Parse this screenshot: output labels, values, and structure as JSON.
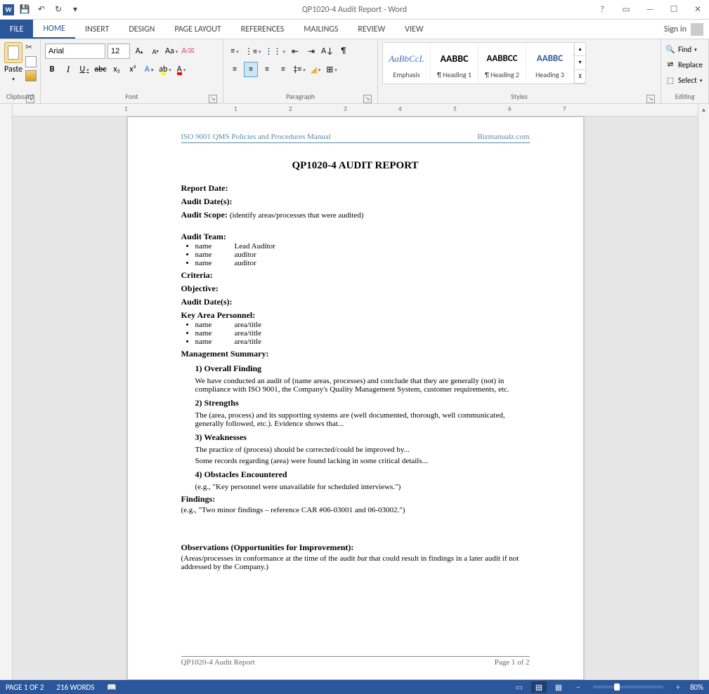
{
  "titlebar": {
    "title": "QP1020-4 Audit Report - Word"
  },
  "qat": {
    "save": "💾",
    "undo": "↶",
    "redo": "↻"
  },
  "tabs": {
    "file": "FILE",
    "home": "HOME",
    "insert": "INSERT",
    "design": "DESIGN",
    "pagelayout": "PAGE LAYOUT",
    "references": "REFERENCES",
    "mailings": "MAILINGS",
    "review": "REVIEW",
    "view": "VIEW",
    "signin": "Sign in"
  },
  "ribbon": {
    "clipboard": {
      "label": "Clipboard",
      "paste": "Paste"
    },
    "font": {
      "label": "Font",
      "name": "Arial",
      "size": "12",
      "bold": "B",
      "italic": "I",
      "underline": "U",
      "strike": "abc",
      "sub": "x₂",
      "sup": "x²",
      "growA": "A",
      "shrinkA": "A",
      "caseAa": "Aa",
      "clear": "⌫",
      "textfx": "A",
      "highlight": "ab",
      "fontcolorA": "A"
    },
    "paragraph": {
      "label": "Paragraph"
    },
    "styles": {
      "label": "Styles",
      "items": [
        {
          "preview": "AaBbCcL",
          "name": "Emphasis",
          "cls": "s1"
        },
        {
          "preview": "AABBC",
          "name": "¶ Heading 1",
          "cls": "s2"
        },
        {
          "preview": "AABBCC",
          "name": "¶ Heading 2",
          "cls": "s3"
        },
        {
          "preview": "AABBC",
          "name": "Heading 3",
          "cls": "s4"
        }
      ]
    },
    "editing": {
      "label": "Editing",
      "find": "Find",
      "replace": "Replace",
      "select": "Select"
    }
  },
  "ruler_numbers": [
    "1",
    "",
    "1",
    "2",
    "3",
    "4",
    "5",
    "6",
    "7"
  ],
  "document": {
    "header_left": "ISO 9001 QMS Policies and Procedures Manual",
    "header_right": "Bizmanualz.com",
    "title": "QP1020-4 AUDIT REPORT",
    "report_date_label": "Report Date:",
    "audit_dates_label": "Audit Date(s):",
    "audit_scope_label": "Audit Scope:",
    "audit_scope_hint": "(identify areas/processes that were audited)",
    "audit_team_label": "Audit Team:",
    "team": [
      {
        "name": "name",
        "role": "Lead Auditor"
      },
      {
        "name": "name",
        "role": "auditor"
      },
      {
        "name": "name",
        "role": "auditor"
      }
    ],
    "criteria_label": "Criteria:",
    "objective_label": "Objective:",
    "audit_dates2_label": "Audit Date(s):",
    "key_personnel_label": "Key Area Personnel:",
    "personnel": [
      {
        "name": "name",
        "role": "area/title"
      },
      {
        "name": "name",
        "role": "area/title"
      },
      {
        "name": "name",
        "role": "area/title"
      }
    ],
    "mgmt_summary_label": "Management Summary:",
    "s1_label": "1) Overall Finding",
    "s1_body": "We have conducted an audit of (name areas, processes) and conclude that they are generally (not) in compliance with ISO 9001, the Company's Quality Management System, customer requirements, etc.",
    "s2_label": "2) Strengths",
    "s2_body": "The (area, process) and its supporting systems are (well documented, thorough, well communicated, generally followed, etc.).  Evidence shows that...",
    "s3_label": "3) Weaknesses",
    "s3_body1": "The practice of (process) should be corrected/could be improved by...",
    "s3_body2": "Some records regarding (area) were found lacking in some critical details...",
    "s4_label": "4) Obstacles Encountered",
    "s4_body": "(e.g., \"Key personnel were unavailable for scheduled interviews.\")",
    "findings_label": "Findings:",
    "findings_body": "(e.g., \"Two minor findings – reference CAR #06-03001 and 06-03002.\")",
    "obs_label": "Observations (Opportunities for Improvement):",
    "obs_body_pre": "(Areas/processes in conformance at the time of the audit ",
    "obs_body_italic": "but",
    "obs_body_post": " that could result in findings in a later audit if not addressed by the Company.)",
    "footer_left": "QP1020-4 Audit Report",
    "footer_right": "Page 1 of 2"
  },
  "statusbar": {
    "page": "PAGE 1 OF 2",
    "words": "216 WORDS",
    "zoom": "80%"
  }
}
